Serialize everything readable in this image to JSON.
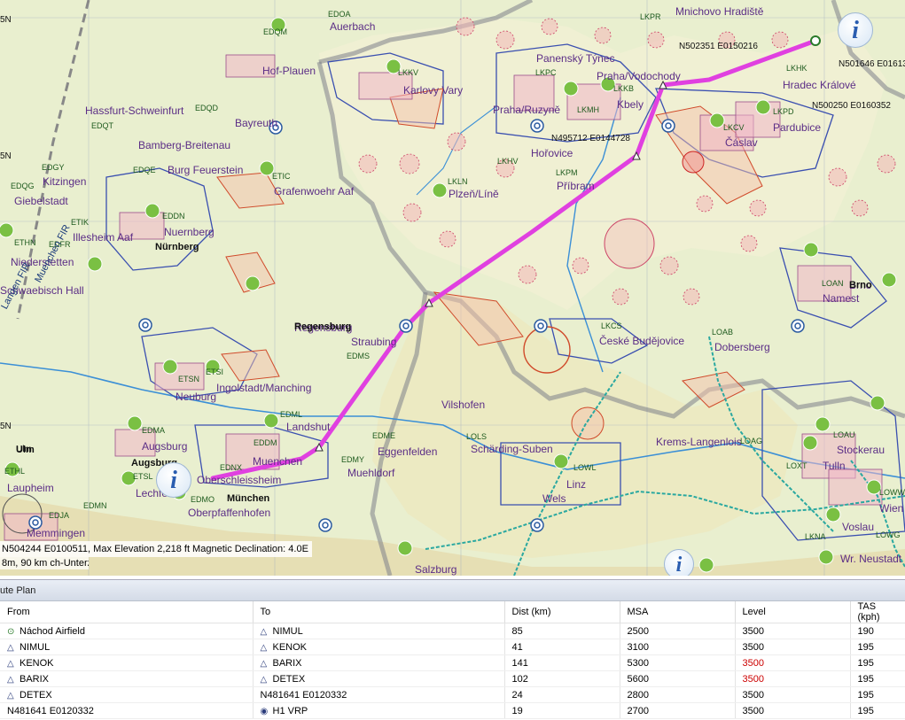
{
  "map": {
    "cities": [
      {
        "name": "Auerbach"
      },
      {
        "name": "Hof-Plauen"
      },
      {
        "name": "Karlovy Vary"
      },
      {
        "name": "Panenský Týnec"
      },
      {
        "name": "Praha/Vodochody"
      },
      {
        "name": "Mnichovo Hradiště"
      },
      {
        "name": "Hradec Králové"
      },
      {
        "name": "Praha/Ruzyně"
      },
      {
        "name": "Kbely"
      },
      {
        "name": "Čáslav"
      },
      {
        "name": "Pardubice"
      },
      {
        "name": "Hořovice"
      },
      {
        "name": "Příbram"
      },
      {
        "name": "Plzeň/Líně"
      },
      {
        "name": "Hassfurt-Schweinfurt"
      },
      {
        "name": "Bamberg-Breitenau"
      },
      {
        "name": "Bayreuth"
      },
      {
        "name": "Burg Feuerstein"
      },
      {
        "name": "Grafenwoehr Aaf"
      },
      {
        "name": "Kitzingen"
      },
      {
        "name": "Giebelstadt"
      },
      {
        "name": "Illesheim Aaf"
      },
      {
        "name": "Nuernberg"
      },
      {
        "name": "Niederstetten"
      },
      {
        "name": "Schwaebisch Hall"
      },
      {
        "name": "Regensburg"
      },
      {
        "name": "Straubing"
      },
      {
        "name": "Ingolstadt/Manching"
      },
      {
        "name": "Neuburg"
      },
      {
        "name": "Vilshofen"
      },
      {
        "name": "Landshut"
      },
      {
        "name": "Augsburg"
      },
      {
        "name": "Muenchen"
      },
      {
        "name": "Eggenfelden"
      },
      {
        "name": "Muehldorf"
      },
      {
        "name": "Oberschleissheim"
      },
      {
        "name": "Oberpfaffenhofen"
      },
      {
        "name": "Lechfeld"
      },
      {
        "name": "Laupheim"
      },
      {
        "name": "Memmingen"
      },
      {
        "name": "Schärding-Suben"
      },
      {
        "name": "Linz"
      },
      {
        "name": "Wels"
      },
      {
        "name": "České Budějovice"
      },
      {
        "name": "Dobersberg"
      },
      {
        "name": "Krems-Langenlois"
      },
      {
        "name": "Stockerau"
      },
      {
        "name": "Tulln"
      },
      {
        "name": "Wien"
      },
      {
        "name": "Voslau"
      },
      {
        "name": "Wr. Neustadt"
      },
      {
        "name": "Salzburg"
      },
      {
        "name": "Namest"
      },
      {
        "name": "Brno"
      }
    ],
    "codes": [
      "EDOA",
      "EDQM",
      "LKKV",
      "LKPC",
      "LKKB",
      "LKPR",
      "LKHK",
      "LKMH",
      "LKCV",
      "LKPD",
      "LKHV",
      "LKPM",
      "LKLN",
      "EDQT",
      "EDQD",
      "EDQE",
      "ETIC",
      "EDGY",
      "EDQG",
      "ETIK",
      "EDDN",
      "ETHN",
      "EDFR",
      "EDMS",
      "ETSN",
      "ETSI",
      "EDMY",
      "EDML",
      "EDDM",
      "EDME",
      "EDNX",
      "EDMA",
      "EDMO",
      "ETSL",
      "ETHL",
      "EDJA",
      "EDMN",
      "LOLS",
      "LOWL",
      "LKCS",
      "LOAB",
      "LOAG",
      "LOAU",
      "LOXT",
      "LOWW",
      "LKNA",
      "LOAN",
      "LOWG"
    ],
    "firs": [
      {
        "name": "Langen FIR"
      },
      {
        "name": "Muenchen FIR"
      }
    ],
    "coords": [
      {
        "name": "N502351 E0150216"
      },
      {
        "name": "N501646 E0161334"
      },
      {
        "name": "N500250 E0160352"
      },
      {
        "name": "N495712 E0144728"
      }
    ],
    "towns": [
      {
        "name": "Nürnberg"
      },
      {
        "name": "Regensburg"
      },
      {
        "name": "Augsburg"
      },
      {
        "name": "München"
      },
      {
        "name": "Ulm"
      },
      {
        "name": "Brno"
      }
    ],
    "edge_labels": [
      "5N",
      "5N",
      "5N",
      "Ulm"
    ],
    "status_text": "N504244 E0100511, Max Elevation 2,218 ft  Magnetic Declination: 4.0E",
    "scale_text": "8m, 90 km",
    "scale_suffix": "ch-Unterzell",
    "info_icon_glyph": "i"
  },
  "route_plan": {
    "title": "ute Plan",
    "columns": [
      "From",
      "To",
      "Dist (km)",
      "MSA",
      "Level",
      "TAS (kph)"
    ],
    "rows": [
      {
        "from": "Náchod Airfield",
        "from_icon": "airfield-icon",
        "to": "NIMUL",
        "to_icon": "waypoint-triangle-icon",
        "dist": "85",
        "msa": "2500",
        "level": "3500",
        "level_warn": false,
        "tas": "190"
      },
      {
        "from": "NIMUL",
        "from_icon": "waypoint-triangle-icon",
        "to": "KENOK",
        "to_icon": "waypoint-triangle-icon",
        "dist": "41",
        "msa": "3100",
        "level": "3500",
        "level_warn": false,
        "tas": "195"
      },
      {
        "from": "KENOK",
        "from_icon": "waypoint-triangle-icon",
        "to": "BARIX",
        "to_icon": "waypoint-triangle-icon",
        "dist": "141",
        "msa": "5300",
        "level": "3500",
        "level_warn": true,
        "tas": "195"
      },
      {
        "from": "BARIX",
        "from_icon": "waypoint-triangle-icon",
        "to": "DETEX",
        "to_icon": "waypoint-triangle-icon",
        "dist": "102",
        "msa": "5600",
        "level": "3500",
        "level_warn": true,
        "tas": "195"
      },
      {
        "from": "DETEX",
        "from_icon": "waypoint-triangle-icon",
        "to": "N481641 E0120332",
        "to_icon": "",
        "dist": "24",
        "msa": "2800",
        "level": "3500",
        "level_warn": false,
        "tas": "195"
      },
      {
        "from": "N481641 E0120332",
        "from_icon": "",
        "to": "H1 VRP",
        "to_icon": "vrp-icon",
        "dist": "19",
        "msa": "2700",
        "level": "3500",
        "level_warn": false,
        "tas": "195"
      }
    ]
  },
  "colors": {
    "route": "#e040e0",
    "level_warning": "#cc0000",
    "map_land": "#e9efcf",
    "airspace_blue": "#3a4fb0",
    "restricted_red": "#d04a2a"
  }
}
